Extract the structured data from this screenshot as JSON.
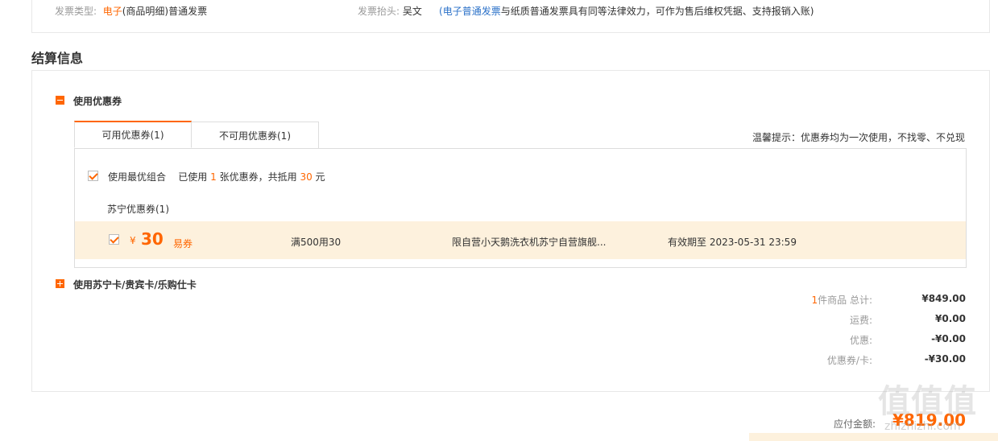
{
  "invoice": {
    "type_label": "发票类型:",
    "type_value_e": "电子",
    "type_value_rest": "(商品明细)普通发票",
    "header_label": "发票抬头:",
    "header_value": "吴文",
    "note_open": "(",
    "note_link": "电子普通发票",
    "note_rest": "与纸质普通发票具有同等法律效力，可作为售后维权凭据、支持报销入账)"
  },
  "settlement": {
    "title": "结算信息",
    "use_coupon_label": "使用优惠券",
    "tabs": [
      {
        "label": "可用优惠券(1)"
      },
      {
        "label": "不可用优惠券(1)"
      }
    ],
    "tip": "温馨提示：优惠券均为一次使用，不找零、不兑现",
    "best_combo": {
      "label": "使用最优组合",
      "used_prefix": "已使用",
      "used_count": "1",
      "used_mid": "张优惠券，共抵用",
      "used_amount": "30",
      "used_suffix": "元"
    },
    "group_label": "苏宁优惠券(1)",
    "coupon": {
      "currency": "¥",
      "amount": "30",
      "kind": "易券",
      "condition": "满500用30",
      "scope": "限自营小天鹅洗衣机苏宁自营旗舰...",
      "validity": "有效期至 2023-05-31 23:59"
    },
    "card_label": "使用苏宁卡/贵宾卡/乐购仕卡"
  },
  "summary": {
    "count": "1",
    "count_label": "件商品 总计:",
    "total": "¥849.00",
    "shipping_label": "运费:",
    "shipping": "¥0.00",
    "discount_label": "优惠:",
    "discount": "-¥0.00",
    "coupon_card_label": "优惠券/卡:",
    "coupon_card": "-¥30.00",
    "payable_label": "应付金额:",
    "payable": "¥819.00"
  },
  "watermark": {
    "main": "值值值",
    "sub": "zhizhizhi.com"
  },
  "colors": {
    "accent": "#ff6600",
    "link": "#2a70c8",
    "highlight_bg": "#fdf1dd"
  }
}
